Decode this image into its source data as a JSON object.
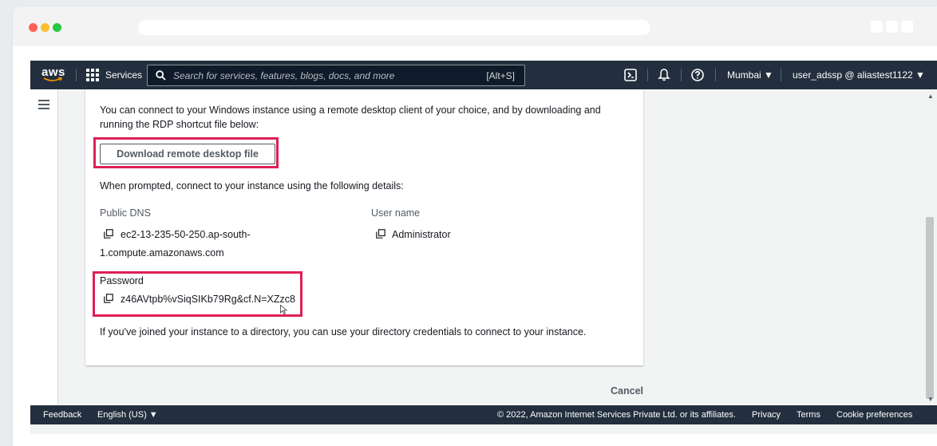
{
  "nav": {
    "logo": "aws",
    "services_label": "Services",
    "search_placeholder": "Search for services, features, blogs, docs, and more",
    "search_shortcut": "[Alt+S]",
    "region": "Mumbai ▼",
    "user": "user_adssp @ aliastest1122 ▼"
  },
  "panel": {
    "intro_text": "You can connect to your Windows instance using a remote desktop client of your choice, and by downloading and running the RDP shortcut file below:",
    "download_button": "Download remote desktop file",
    "prompted_text": "When prompted, connect to your instance using the following details:",
    "public_dns_label": "Public DNS",
    "public_dns_line1": "ec2-13-235-50-250.ap-south-",
    "public_dns_line2": "1.compute.amazonaws.com",
    "username_label": "User name",
    "username_value": "Administrator",
    "password_label": "Password",
    "password_value": "z46AVtpb%vSiqSIKb79Rg&cf.N=XZzc8",
    "directory_note": "If you've joined your instance to a directory, you can use your directory credentials to connect to your instance."
  },
  "actions": {
    "cancel": "Cancel"
  },
  "footer": {
    "feedback": "Feedback",
    "language": "English (US) ▼",
    "copyright": "© 2022, Amazon Internet Services Private Ltd. or its affiliates.",
    "privacy": "Privacy",
    "terms": "Terms",
    "cookies": "Cookie preferences"
  },
  "colors": {
    "nav_bg": "#232f3e",
    "highlight": "#e01f56",
    "aws_orange": "#ff9900"
  }
}
